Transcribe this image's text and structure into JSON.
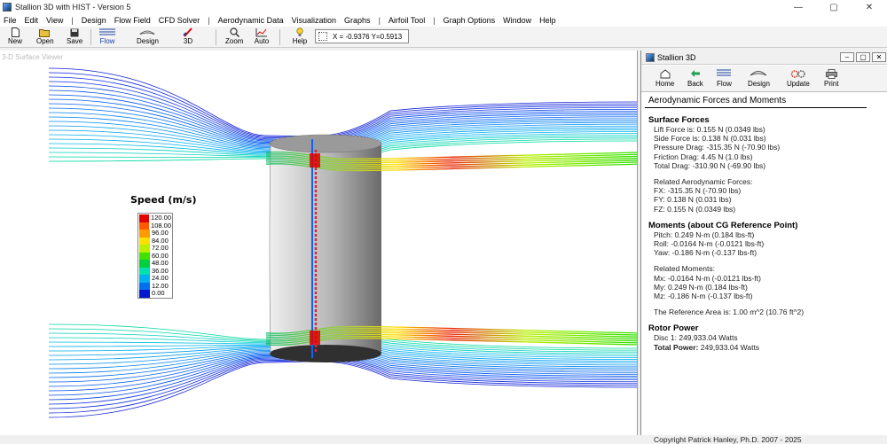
{
  "window": {
    "title": "Stallion 3D with HIST - Version 5",
    "minimize": "—",
    "maximize": "▢",
    "close": "✕"
  },
  "menu": [
    "File",
    "Edit",
    "View",
    "|",
    "Design",
    "Flow Field",
    "CFD Solver",
    "|",
    "Aerodynamic Data",
    "Visualization",
    "Graphs",
    "|",
    "Airfoil Tool",
    "|",
    "Graph Options",
    "Window",
    "Help"
  ],
  "toolbar": {
    "new": "New",
    "open": "Open",
    "save": "Save",
    "flow": "Flow",
    "design": "Design",
    "view3d": "3D",
    "zoom": "Zoom",
    "auto": "Auto",
    "help": "Help",
    "coords": "X = -0.9376  Y=0.5913"
  },
  "viewer": {
    "title": "3-D Surface Viewer",
    "legend_title": "Speed (m/s)",
    "legend": [
      {
        "value": "120.00",
        "color": "#e00000"
      },
      {
        "value": "108.00",
        "color": "#ff5a00"
      },
      {
        "value": "96.00",
        "color": "#ff9a00"
      },
      {
        "value": "84.00",
        "color": "#ffe000"
      },
      {
        "value": "72.00",
        "color": "#b8f000"
      },
      {
        "value": "60.00",
        "color": "#40e000"
      },
      {
        "value": "48.00",
        "color": "#00d040"
      },
      {
        "value": "36.00",
        "color": "#00e0b0"
      },
      {
        "value": "24.00",
        "color": "#00b0f0"
      },
      {
        "value": "12.00",
        "color": "#0070f0"
      },
      {
        "value": "0.00",
        "color": "#0018d0"
      }
    ]
  },
  "panel": {
    "title": "Stallion 3D",
    "toolbar": {
      "home": "Home",
      "back": "Back",
      "flow": "Flow",
      "design": "Design",
      "update": "Update",
      "print": "Print"
    },
    "header": "Aerodynamic Forces and Moments",
    "surface_forces": {
      "title": "Surface Forces",
      "lines": [
        "Lift Force is: 0.155 N (0.0349 lbs)",
        "Side Force is: 0.138 N (0.031 lbs)",
        "Pressure Drag: -315.35 N (-70.90 lbs)",
        "Friction Drag: 4.45 N (1.0 lbs)",
        "Total Drag: -310.90 N (-69.90 lbs)"
      ],
      "related_title": "Related Aerodynamic Forces:",
      "related": [
        "FX: -315.35 N (-70.90 lbs)",
        "FY: 0.138 N (0.031 lbs)",
        "FZ: 0.155 N (0.0349 lbs)"
      ]
    },
    "moments": {
      "title": "Moments (about CG Reference Point)",
      "lines": [
        "Pitch: 0.249 N-m (0.184 lbs-ft)",
        "Roll: -0.0164 N-m (-0.0121 lbs-ft)",
        "Yaw: -0.186 N-m (-0.137 lbs-ft)"
      ],
      "related_title": "Related Moments:",
      "related": [
        "Mx: -0.0164 N-m (-0.0121 lbs-ft)",
        "My: 0.249 N-m (0.184 lbs-ft)",
        "Mz: -0.186 N-m (-0.137 lbs-ft)"
      ],
      "reference_area": "The Reference Area is: 1.00 m^2 (10.76 ft^2)"
    },
    "rotor": {
      "title": "Rotor Power",
      "disc": "Disc 1: 249,933.04 Watts",
      "total_label": "Total Power:",
      "total_value": "249,933.04 Watts"
    },
    "copyright": "Copyright Patrick Hanley, Ph.D. 2007 - 2025"
  }
}
